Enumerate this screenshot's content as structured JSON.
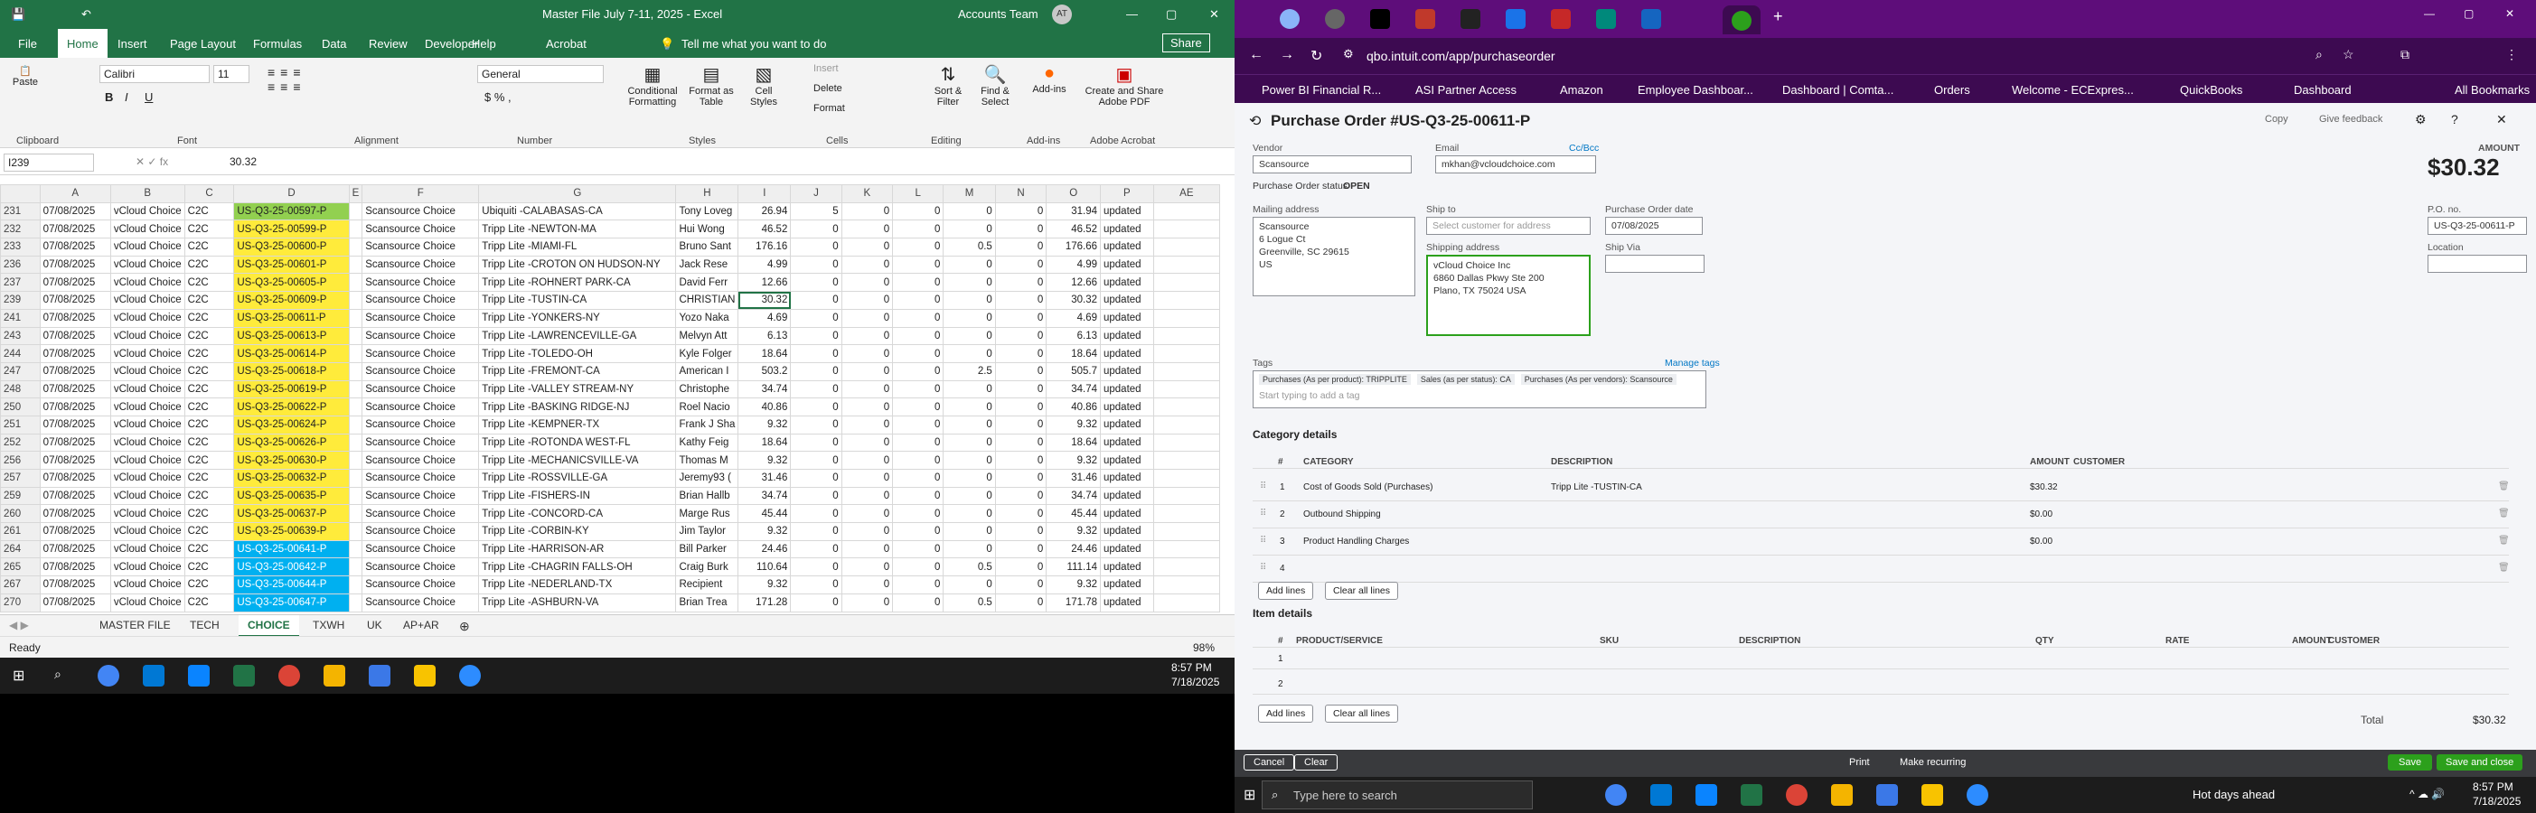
{
  "excel": {
    "title": "Master File July 7-11, 2025  -  Excel",
    "account": "Accounts Team",
    "avatar_initials": "AT",
    "tabs": [
      "File",
      "Home",
      "Insert",
      "Page Layout",
      "Formulas",
      "Data",
      "Review",
      "Developer",
      "Help",
      "Acrobat"
    ],
    "tell_me": "Tell me what you want to do",
    "share": "Share",
    "font_name": "Calibri",
    "font_size": "11",
    "number_format": "General",
    "ribbon_groups": [
      "Clipboard",
      "Font",
      "Alignment",
      "Number",
      "Styles",
      "Cells",
      "Editing",
      "Add-ins",
      "Adobe Acrobat"
    ],
    "ribbon_buttons": [
      "Conditional Formatting",
      "Format as Table",
      "Cell Styles",
      "Insert",
      "Delete",
      "Format",
      "Sort & Filter",
      "Find & Select",
      "Add-ins",
      "Create and Share Adobe PDF"
    ],
    "name_box": "I239",
    "formula_value": "30.32",
    "columns": [
      "A",
      "B",
      "C",
      "D",
      "E",
      "F",
      "G",
      "H",
      "I",
      "J",
      "K",
      "L",
      "M",
      "N",
      "O",
      "P",
      "AE"
    ],
    "rows": [
      {
        "r": "231",
        "a": "07/08/2025",
        "b": "vCloud Choice",
        "c": "C2C",
        "d": "US-Q3-25-00597-P",
        "dc": "grn",
        "f": "Scansource Choice",
        "g": "Ubiquiti -CALABASAS-CA",
        "h": "Tony Loveg",
        "i": "26.94",
        "j": "5",
        "k": "0",
        "l": "0",
        "m": "0",
        "n": "0",
        "o": "31.94",
        "p": "updated"
      },
      {
        "r": "232",
        "a": "07/08/2025",
        "b": "vCloud Choice",
        "c": "C2C",
        "d": "US-Q3-25-00599-P",
        "dc": "yel",
        "f": "Scansource Choice",
        "g": "Tripp Lite -NEWTON-MA",
        "h": "Hui Wong",
        "i": "46.52",
        "j": "0",
        "k": "0",
        "l": "0",
        "m": "0",
        "n": "0",
        "o": "46.52",
        "p": "updated"
      },
      {
        "r": "233",
        "a": "07/08/2025",
        "b": "vCloud Choice",
        "c": "C2C",
        "d": "US-Q3-25-00600-P",
        "dc": "yel",
        "f": "Scansource Choice",
        "g": "Tripp Lite -MIAMI-FL",
        "h": "Bruno Sant",
        "i": "176.16",
        "j": "0",
        "k": "0",
        "l": "0",
        "m": "0.5",
        "n": "0",
        "o": "176.66",
        "p": "updated"
      },
      {
        "r": "236",
        "a": "07/08/2025",
        "b": "vCloud Choice",
        "c": "C2C",
        "d": "US-Q3-25-00601-P",
        "dc": "yel",
        "f": "Scansource Choice",
        "g": "Tripp Lite -CROTON ON HUDSON-NY",
        "h": "Jack Rese",
        "i": "4.99",
        "j": "0",
        "k": "0",
        "l": "0",
        "m": "0",
        "n": "0",
        "o": "4.99",
        "p": "updated"
      },
      {
        "r": "237",
        "a": "07/08/2025",
        "b": "vCloud Choice",
        "c": "C2C",
        "d": "US-Q3-25-00605-P",
        "dc": "yel",
        "f": "Scansource Choice",
        "g": "Tripp Lite -ROHNERT PARK-CA",
        "h": "David Ferr",
        "i": "12.66",
        "j": "0",
        "k": "0",
        "l": "0",
        "m": "0",
        "n": "0",
        "o": "12.66",
        "p": "updated"
      },
      {
        "r": "239",
        "a": "07/08/2025",
        "b": "vCloud Choice",
        "c": "C2C",
        "d": "US-Q3-25-00609-P",
        "dc": "yel",
        "f": "Scansource Choice",
        "g": "Tripp Lite -TUSTIN-CA",
        "h": "CHRISTIAN",
        "i": "30.32",
        "j": "0",
        "k": "0",
        "l": "0",
        "m": "0",
        "n": "0",
        "o": "30.32",
        "p": "updated",
        "sel": true
      },
      {
        "r": "241",
        "a": "07/08/2025",
        "b": "vCloud Choice",
        "c": "C2C",
        "d": "US-Q3-25-00611-P",
        "dc": "yel",
        "f": "Scansource Choice",
        "g": "Tripp Lite -YONKERS-NY",
        "h": "Yozo Naka",
        "i": "4.69",
        "j": "0",
        "k": "0",
        "l": "0",
        "m": "0",
        "n": "0",
        "o": "4.69",
        "p": "updated"
      },
      {
        "r": "243",
        "a": "07/08/2025",
        "b": "vCloud Choice",
        "c": "C2C",
        "d": "US-Q3-25-00613-P",
        "dc": "yel",
        "f": "Scansource Choice",
        "g": "Tripp Lite -LAWRENCEVILLE-GA",
        "h": "Melvyn Att",
        "i": "6.13",
        "j": "0",
        "k": "0",
        "l": "0",
        "m": "0",
        "n": "0",
        "o": "6.13",
        "p": "updated"
      },
      {
        "r": "244",
        "a": "07/08/2025",
        "b": "vCloud Choice",
        "c": "C2C",
        "d": "US-Q3-25-00614-P",
        "dc": "yel",
        "f": "Scansource Choice",
        "g": "Tripp Lite -TOLEDO-OH",
        "h": "Kyle Folger",
        "i": "18.64",
        "j": "0",
        "k": "0",
        "l": "0",
        "m": "0",
        "n": "0",
        "o": "18.64",
        "p": "updated"
      },
      {
        "r": "247",
        "a": "07/08/2025",
        "b": "vCloud Choice",
        "c": "C2C",
        "d": "US-Q3-25-00618-P",
        "dc": "yel",
        "f": "Scansource Choice",
        "g": "Tripp Lite -FREMONT-CA",
        "h": "American I",
        "i": "503.2",
        "j": "0",
        "k": "0",
        "l": "0",
        "m": "2.5",
        "n": "0",
        "o": "505.7",
        "p": "updated"
      },
      {
        "r": "248",
        "a": "07/08/2025",
        "b": "vCloud Choice",
        "c": "C2C",
        "d": "US-Q3-25-00619-P",
        "dc": "yel",
        "f": "Scansource Choice",
        "g": "Tripp Lite -VALLEY STREAM-NY",
        "h": "Christophe",
        "i": "34.74",
        "j": "0",
        "k": "0",
        "l": "0",
        "m": "0",
        "n": "0",
        "o": "34.74",
        "p": "updated"
      },
      {
        "r": "250",
        "a": "07/08/2025",
        "b": "vCloud Choice",
        "c": "C2C",
        "d": "US-Q3-25-00622-P",
        "dc": "yel",
        "f": "Scansource Choice",
        "g": "Tripp Lite -BASKING RIDGE-NJ",
        "h": "Roel Nacio",
        "i": "40.86",
        "j": "0",
        "k": "0",
        "l": "0",
        "m": "0",
        "n": "0",
        "o": "40.86",
        "p": "updated"
      },
      {
        "r": "251",
        "a": "07/08/2025",
        "b": "vCloud Choice",
        "c": "C2C",
        "d": "US-Q3-25-00624-P",
        "dc": "yel",
        "f": "Scansource Choice",
        "g": "Tripp Lite -KEMPNER-TX",
        "h": "Frank J Sha",
        "i": "9.32",
        "j": "0",
        "k": "0",
        "l": "0",
        "m": "0",
        "n": "0",
        "o": "9.32",
        "p": "updated"
      },
      {
        "r": "252",
        "a": "07/08/2025",
        "b": "vCloud Choice",
        "c": "C2C",
        "d": "US-Q3-25-00626-P",
        "dc": "yel",
        "f": "Scansource Choice",
        "g": "Tripp Lite -ROTONDA WEST-FL",
        "h": "Kathy Feig",
        "i": "18.64",
        "j": "0",
        "k": "0",
        "l": "0",
        "m": "0",
        "n": "0",
        "o": "18.64",
        "p": "updated"
      },
      {
        "r": "256",
        "a": "07/08/2025",
        "b": "vCloud Choice",
        "c": "C2C",
        "d": "US-Q3-25-00630-P",
        "dc": "yel",
        "f": "Scansource Choice",
        "g": "Tripp Lite -MECHANICSVILLE-VA",
        "h": "Thomas M",
        "i": "9.32",
        "j": "0",
        "k": "0",
        "l": "0",
        "m": "0",
        "n": "0",
        "o": "9.32",
        "p": "updated"
      },
      {
        "r": "257",
        "a": "07/08/2025",
        "b": "vCloud Choice",
        "c": "C2C",
        "d": "US-Q3-25-00632-P",
        "dc": "yel",
        "f": "Scansource Choice",
        "g": "Tripp Lite -ROSSVILLE-GA",
        "h": "Jeremy93 (",
        "i": "31.46",
        "j": "0",
        "k": "0",
        "l": "0",
        "m": "0",
        "n": "0",
        "o": "31.46",
        "p": "updated"
      },
      {
        "r": "259",
        "a": "07/08/2025",
        "b": "vCloud Choice",
        "c": "C2C",
        "d": "US-Q3-25-00635-P",
        "dc": "yel",
        "f": "Scansource Choice",
        "g": "Tripp Lite -FISHERS-IN",
        "h": "Brian Hallb",
        "i": "34.74",
        "j": "0",
        "k": "0",
        "l": "0",
        "m": "0",
        "n": "0",
        "o": "34.74",
        "p": "updated"
      },
      {
        "r": "260",
        "a": "07/08/2025",
        "b": "vCloud Choice",
        "c": "C2C",
        "d": "US-Q3-25-00637-P",
        "dc": "yel",
        "f": "Scansource Choice",
        "g": "Tripp Lite -CONCORD-CA",
        "h": "Marge Rus",
        "i": "45.44",
        "j": "0",
        "k": "0",
        "l": "0",
        "m": "0",
        "n": "0",
        "o": "45.44",
        "p": "updated"
      },
      {
        "r": "261",
        "a": "07/08/2025",
        "b": "vCloud Choice",
        "c": "C2C",
        "d": "US-Q3-25-00639-P",
        "dc": "yel",
        "f": "Scansource Choice",
        "g": "Tripp Lite -CORBIN-KY",
        "h": "Jim Taylor",
        "i": "9.32",
        "j": "0",
        "k": "0",
        "l": "0",
        "m": "0",
        "n": "0",
        "o": "9.32",
        "p": "updated"
      },
      {
        "r": "264",
        "a": "07/08/2025",
        "b": "vCloud Choice",
        "c": "C2C",
        "d": "US-Q3-25-00641-P",
        "dc": "blu",
        "f": "Scansource Choice",
        "g": "Tripp Lite -HARRISON-AR",
        "h": "Bill Parker",
        "i": "24.46",
        "j": "0",
        "k": "0",
        "l": "0",
        "m": "0",
        "n": "0",
        "o": "24.46",
        "p": "updated"
      },
      {
        "r": "265",
        "a": "07/08/2025",
        "b": "vCloud Choice",
        "c": "C2C",
        "d": "US-Q3-25-00642-P",
        "dc": "blu",
        "f": "Scansource Choice",
        "g": "Tripp Lite -CHAGRIN FALLS-OH",
        "h": "Craig Burk",
        "i": "110.64",
        "j": "0",
        "k": "0",
        "l": "0",
        "m": "0.5",
        "n": "0",
        "o": "111.14",
        "p": "updated"
      },
      {
        "r": "267",
        "a": "07/08/2025",
        "b": "vCloud Choice",
        "c": "C2C",
        "d": "US-Q3-25-00644-P",
        "dc": "blu",
        "f": "Scansource Choice",
        "g": "Tripp Lite -NEDERLAND-TX",
        "h": "Recipient",
        "i": "9.32",
        "j": "0",
        "k": "0",
        "l": "0",
        "m": "0",
        "n": "0",
        "o": "9.32",
        "p": "updated"
      },
      {
        "r": "270",
        "a": "07/08/2025",
        "b": "vCloud Choice",
        "c": "C2C",
        "d": "US-Q3-25-00647-P",
        "dc": "blu",
        "f": "Scansource Choice",
        "g": "Tripp Lite -ASHBURN-VA",
        "h": "Brian Trea",
        "i": "171.28",
        "j": "0",
        "k": "0",
        "l": "0",
        "m": "0.5",
        "n": "0",
        "o": "171.78",
        "p": "updated"
      }
    ],
    "sheet_tabs": [
      "MASTER FILE",
      "TECH",
      "CHOICE",
      "TXWH",
      "UK",
      "AP+AR"
    ],
    "active_sheet": "CHOICE",
    "status": "Ready",
    "zoom": "98%",
    "clock_time": "8:57 PM",
    "clock_date": "7/18/2025"
  },
  "browser": {
    "url": "qbo.intuit.com/app/purchaseorder",
    "bookmarks": [
      "Power BI Financial R...",
      "ASI Partner Access",
      "Amazon",
      "Employee Dashboar...",
      "Dashboard | Comta...",
      "Orders",
      "Welcome - ECExpres...",
      "QuickBooks",
      "Dashboard"
    ],
    "po_title": "Purchase Order #US-Q3-25-00611-P",
    "copy": "Copy",
    "feedback": "Give feedback",
    "vendor_label": "Vendor",
    "vendor": "Scansource",
    "email_label": "Email",
    "email": "mkhan@vcloudchoice.com",
    "ccbcc": "Cc/Bcc",
    "status_label": "Purchase Order status",
    "status": "OPEN",
    "amount_label": "AMOUNT",
    "amount": "$30.32",
    "mailing_label": "Mailing address",
    "mailing": [
      "Scansource",
      "6 Logue Ct",
      "Greenville, SC 29615",
      "US"
    ],
    "shipto_label": "Ship to",
    "shipto_placeholder": "Select customer for address",
    "po_date_label": "Purchase Order date",
    "po_date": "07/08/2025",
    "ponum_label": "P.O. no.",
    "ponum": "US-Q3-25-00611-P",
    "shipaddr_label": "Shipping address",
    "shipaddr": [
      "vCloud Choice Inc",
      "6860 Dallas Pkwy Ste 200",
      "Plano, TX  75024 USA"
    ],
    "shipvia_label": "Ship Via",
    "location_label": "Location",
    "tags_label": "Tags",
    "manage_tags": "Manage tags",
    "tags": [
      "Purchases (As per product): TRIPPLITE",
      "Sales (as per status): CA",
      "Purchases (As per vendors): Scansource"
    ],
    "tag_placeholder": "Start typing to add a tag",
    "cat_title": "Category details",
    "cat_headers": [
      "#",
      "CATEGORY",
      "DESCRIPTION",
      "AMOUNT",
      "CUSTOMER"
    ],
    "cat_rows": [
      {
        "n": "1",
        "cat": "Cost of Goods Sold (Purchases)",
        "desc": "Tripp Lite -TUSTIN-CA",
        "amt": "$30.32"
      },
      {
        "n": "2",
        "cat": "Outbound Shipping",
        "desc": "",
        "amt": "$0.00"
      },
      {
        "n": "3",
        "cat": "Product Handling Charges",
        "desc": "",
        "amt": "$0.00"
      },
      {
        "n": "4",
        "cat": "",
        "desc": "",
        "amt": ""
      }
    ],
    "add_lines": "Add lines",
    "clear_lines": "Clear all lines",
    "item_title": "Item details",
    "item_headers": [
      "#",
      "PRODUCT/SERVICE",
      "SKU",
      "DESCRIPTION",
      "QTY",
      "RATE",
      "AMOUNT",
      "CUSTOMER"
    ],
    "item_rows": [
      "1",
      "2"
    ],
    "total_label": "Total",
    "total": "$30.32",
    "cancel": "Cancel",
    "clear": "Clear",
    "print": "Print",
    "make_recurring": "Make recurring",
    "save": "Save",
    "save_close": "Save and close",
    "search_placeholder": "Type here to search",
    "weather": "Hot days ahead",
    "clock_time": "8:57 PM",
    "clock_date": "7/18/2025"
  }
}
